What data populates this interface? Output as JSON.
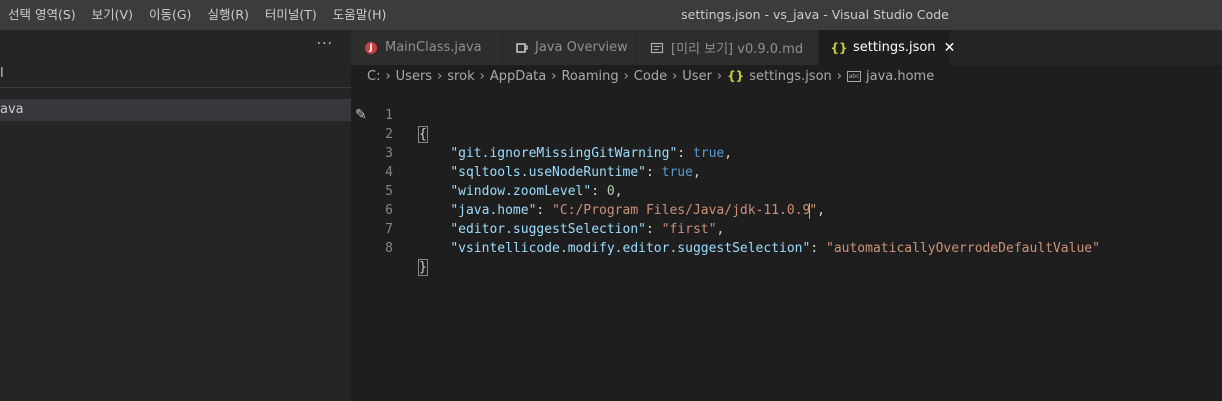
{
  "menu": [
    "선택 영역(S)",
    "보기(V)",
    "이동(G)",
    "실행(R)",
    "터미널(T)",
    "도움말(H)"
  ],
  "window_title": "settings.json - vs_java - Visual Studio Code",
  "sidebar": {
    "more": "···",
    "line1": "l",
    "selected_item": "ava"
  },
  "tabs": [
    {
      "label": "MainClass.java",
      "icon": "java-icon"
    },
    {
      "label": "Java Overview",
      "icon": "cup-icon"
    },
    {
      "label": "[미리 보기] v0.9.0.md",
      "icon": "preview-icon"
    },
    {
      "label": "settings.json",
      "icon": "json-braces-icon",
      "active": true,
      "close": "✕"
    }
  ],
  "breadcrumb": [
    "C:",
    "Users",
    "srok",
    "AppData",
    "Roaming",
    "Code",
    "User",
    "settings.json",
    "java.home"
  ],
  "code": {
    "line_numbers": [
      "1",
      "2",
      "3",
      "4",
      "5",
      "6",
      "7",
      "8"
    ],
    "open_brace": "{",
    "close_brace": "}",
    "entries": [
      {
        "key": "\"git.ignoreMissingGitWarning\"",
        "value": "true",
        "kind": "bool",
        "comma": ","
      },
      {
        "key": "\"sqltools.useNodeRuntime\"",
        "value": "true",
        "kind": "bool",
        "comma": ","
      },
      {
        "key": "\"window.zoomLevel\"",
        "value": "0",
        "kind": "num",
        "comma": ","
      },
      {
        "key": "\"java.home\"",
        "value": "\"C:/Program Files/Java/jdk-11.0.9",
        "value_end": "\"",
        "kind": "str",
        "comma": ","
      },
      {
        "key": "\"editor.suggestSelection\"",
        "value": "\"first\"",
        "kind": "str",
        "comma": ","
      },
      {
        "key": "\"vsintellicode.modify.editor.suggestSelection\"",
        "value": "\"automaticallyOverrodeDefaultValue\"",
        "kind": "str",
        "comma": ""
      }
    ]
  },
  "colors": {
    "background": "#1e1e1e",
    "titlebar": "#3c3c3c",
    "sidebar": "#252526",
    "key": "#9cdcfe",
    "string": "#ce9178",
    "boolean": "#569cd6",
    "number": "#b5cea8"
  }
}
